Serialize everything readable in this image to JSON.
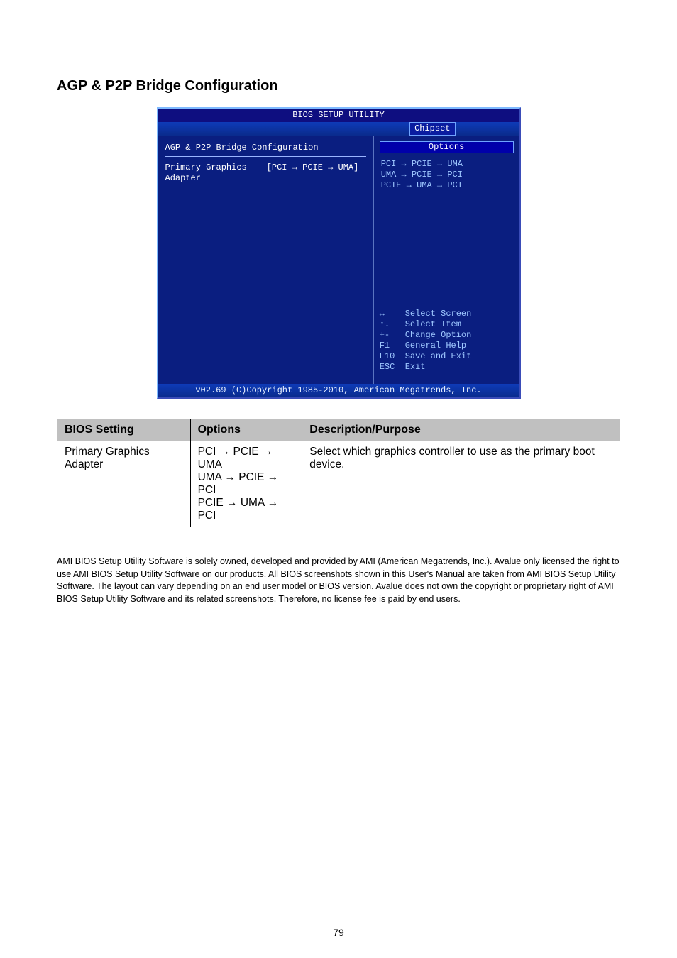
{
  "section_title": "AGP & P2P Bridge Configuration",
  "bios": {
    "window_title": "BIOS SETUP UTILITY",
    "tab": "Chipset",
    "left_heading": "AGP & P2P Bridge Configuration",
    "setting_label": "Primary Graphics Adapter",
    "setting_value": "[PCI → PCIE → UMA]",
    "options_header": "Options",
    "options": [
      "PCI → PCIE → UMA",
      "UMA → PCIE → PCI",
      "PCIE → UMA → PCI"
    ],
    "help": [
      {
        "key": "↔",
        "label": "Select Screen"
      },
      {
        "key": "↑↓",
        "label": "Select Item"
      },
      {
        "key": "+-",
        "label": "Change Option"
      },
      {
        "key": "F1",
        "label": "General Help"
      },
      {
        "key": "F10",
        "label": "Save and Exit"
      },
      {
        "key": "ESC",
        "label": "Exit"
      }
    ],
    "footer": "v02.69 (C)Copyright 1985-2010, American Megatrends, Inc."
  },
  "table": {
    "headers": [
      "BIOS Setting",
      "Options",
      "Description/Purpose"
    ],
    "row": {
      "setting": "Primary Graphics Adapter",
      "options": "PCI → PCIE → UMA\nUMA → PCIE → PCI\nPCIE → UMA → PCI",
      "desc": "Select which graphics controller to use as the primary boot device."
    }
  },
  "footnote": "AMI BIOS Setup Utility Software is solely owned, developed and provided by AMI (American Megatrends, Inc.). Avalue only licensed the right to use AMI BIOS Setup Utility Software on our products. All BIOS screenshots shown in this User's Manual are taken from AMI BIOS Setup Utility Software. The layout can vary depending on an end user model or BIOS version. Avalue does not own the copyright or proprietary right of AMI BIOS Setup Utility Software and its related screenshots. Therefore, no license fee is paid by end users.",
  "page_number": "79"
}
